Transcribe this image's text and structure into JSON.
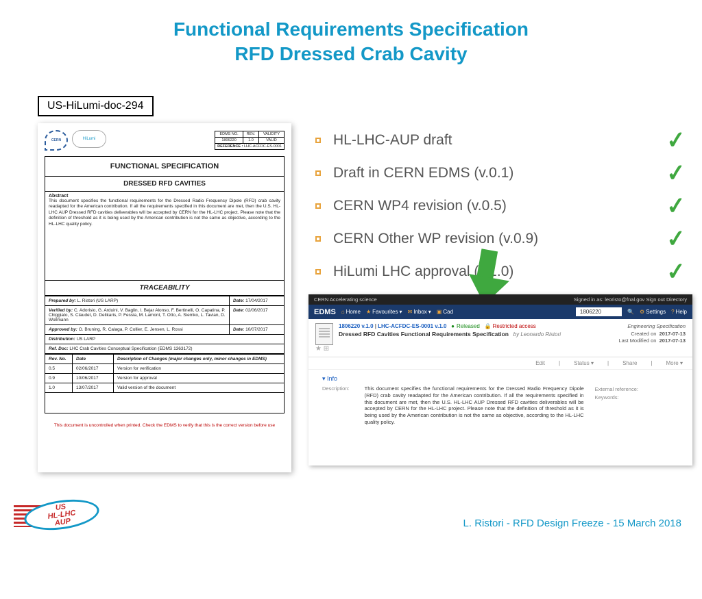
{
  "title_l1": "Functional Requirements Specification",
  "title_l2": "RFD Dressed Crab Cavity",
  "docref": "US-HiLumi-doc-294",
  "bullets": [
    "HL-LHC-AUP draft",
    "Draft in CERN EDMS (v.0.1)",
    "CERN WP4 revision (v.0.5)",
    "CERN Other WP revision (v.0.9)",
    "HiLumi LHC approval (v.1.0)"
  ],
  "spec": {
    "logo1": "CERN",
    "logo2": "HiLumi",
    "edms_no_h": "EDMS NO.",
    "edms_no": "1806220",
    "rev_h": "REV.",
    "rev": "1.0",
    "val_h": "VALIDITY",
    "val": "VALID",
    "ref_h": "REFERENCE :",
    "ref": "LHC-ACFDC-ES-0001",
    "h1": "FUNCTIONAL SPECIFICATION",
    "h2": "DRESSED RFD CAVITIES",
    "abs_lbl": "Abstract",
    "abs": "This document specifies the functional requirements for the Dressed Radio Frequency Dipole (RFD) crab cavity readapted for the American contribution. If all the requirements specified in this document are met, then the U.S. HL-LHC AUP Dressed RFD cavities deliverables will be accepted by CERN for the HL-LHC project. Please note that the definition of threshold as it is being used by the American contribution is not the same as objective, according to the HL-LHC quality policy.",
    "trace_h": "TRACEABILITY",
    "prep_l": "Prepared by:",
    "prep": "L. Ristori (US LARP)",
    "prep_d_l": "Date:",
    "prep_d": "17/04/2017",
    "verif_l": "Verified by:",
    "verif": "C. Adorisio, G. Arduini, V. Baglin, I. Bejar Alonso, F. Bertinelli, O. Capatina, P. Chiggiato, S. Claudet, D. Delikaris, P. Fessia, M. Lamont, T. Otto, A. Siemko, L. Tavian, D. Wollmann",
    "verif_d_l": "Date:",
    "verif_d": "02/06/2017",
    "appr_l": "Approved by:",
    "appr": "O. Bruning, R. Calaga, P. Collier, E. Jensen, L. Rossi",
    "appr_d_l": "Date:",
    "appr_d": "10/07/2017",
    "dist_l": "Distribution:",
    "dist": "US LARP",
    "refdoc_l": "Ref. Doc:",
    "refdoc": "LHC Crab Cavities Conceptual Specification (EDMS 1363172)",
    "rev_no_h": "Rev. No.",
    "date_h": "Date",
    "desc_h": "Description of Changes (major changes only, minor changes in EDMS)",
    "r1": {
      "n": "0.5",
      "d": "02/06/2017",
      "desc": "Version for verification"
    },
    "r2": {
      "n": "0.9",
      "d": "10/06/2017",
      "desc": "Version for approval"
    },
    "r3": {
      "n": "1.0",
      "d": "13/07/2017",
      "desc": "Valid version of the document"
    },
    "footer": "This document is uncontrolled when printed. Check the EDMS to verify that this is the correct version before use"
  },
  "edms": {
    "top_l": "CERN Accelerating science",
    "top_r": "Signed in as:  leoristo@fnal.gov    Sign out    Directory",
    "brand": "EDMS",
    "nav": {
      "home": "Home",
      "fav": "Favourites",
      "inbox": "Inbox",
      "cad": "Cad"
    },
    "search": "1806220",
    "nav_r": {
      "settings": "Settings",
      "help": "Help"
    },
    "doc": {
      "id": "1806220 v.1.0",
      "sep": "|",
      "code": "LHC-ACFDC-ES-0001 v.1.0",
      "released": "Released",
      "restricted": "Restricted access",
      "type": "Engineering Specification",
      "title": "Dressed RFD Cavities Functional Requirements Specification",
      "author": "by Leonardo Ristori",
      "created_l": "Created on",
      "created": "2017-07-13",
      "mod_l": "Last Modified on",
      "mod": "2017-07-13"
    },
    "actions": {
      "edit": "Edit",
      "status": "Status",
      "share": "Share",
      "more": "More"
    },
    "info_h": "Info",
    "desc_l": "Description:",
    "desc": "This document specifies the functional requirements for the Dressed Radio Frequency Dipole (RFD) crab cavity readapted for the American contribution. If all the requirements specified in this document are met, then the U.S. HL-LHC AUP Dressed RFD cavities deliverables will be accepted by CERN for the HL-LHC project. Please note that the definition of threshold as it is being used by the American contribution is not the same as objective, according to the HL-LHC quality policy.",
    "ext_l": "External reference:",
    "kw_l": "Keywords:"
  },
  "footer_logo": {
    "l1": "US",
    "l2": "HL-LHC",
    "l3": "AUP"
  },
  "footer_text": "L. Ristori - RFD Design Freeze - 15 March 2018"
}
